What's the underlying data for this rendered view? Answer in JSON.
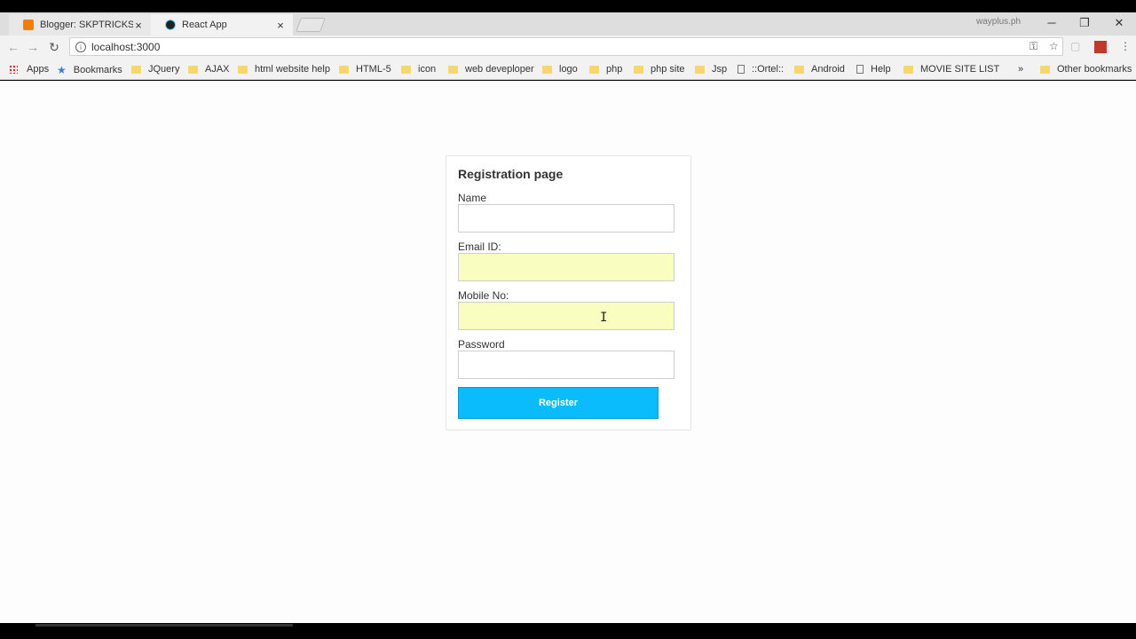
{
  "browser": {
    "tabs": [
      {
        "title": "Blogger: SKPTRICKS - Pri",
        "active": false,
        "favicon": "blogger-icon"
      },
      {
        "title": "React App",
        "active": true,
        "favicon": "react-icon"
      }
    ],
    "profile_name": "wayplus.ph",
    "url": "localhost:3000",
    "bookmarks": {
      "apps": "Apps",
      "items": [
        "Bookmarks",
        "JQuery",
        "AJAX",
        "html website help",
        "HTML-5",
        "icon",
        "web deveploper",
        "logo",
        "php",
        "php site",
        "Jsp",
        "::Ortel::",
        "Android",
        "Help",
        "MOVIE SITE LIST"
      ],
      "overflow": "»",
      "other": "Other bookmarks"
    }
  },
  "form": {
    "title": "Registration page",
    "fields": [
      {
        "label": "Name",
        "value": "",
        "autofill": false
      },
      {
        "label": "Email ID:",
        "value": "",
        "autofill": true
      },
      {
        "label": "Mobile No:",
        "value": "",
        "autofill": true
      },
      {
        "label": "Password",
        "value": "",
        "autofill": false
      }
    ],
    "submit_label": "Register"
  },
  "colors": {
    "button": "#0abcfb",
    "autofill": "#fafdc0"
  }
}
